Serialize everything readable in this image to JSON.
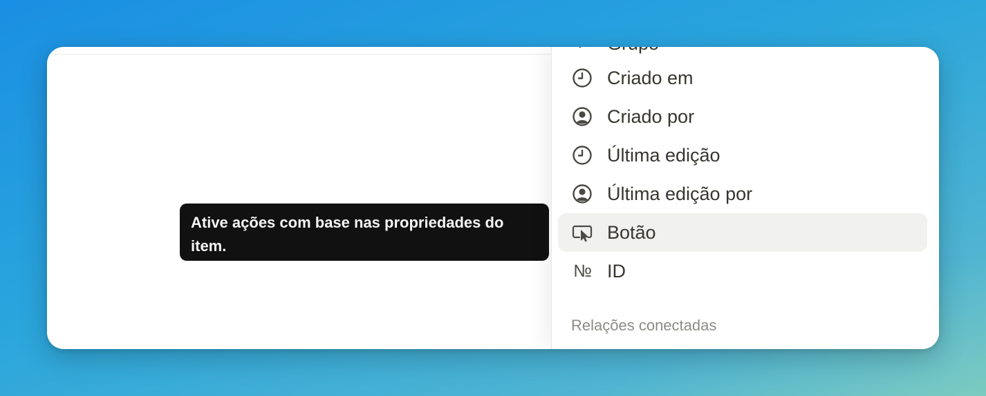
{
  "menu": {
    "partial_item": {
      "label": "Grupo",
      "icon": "partial-icon"
    },
    "items": [
      {
        "label": "Criado em",
        "icon": "clock-icon"
      },
      {
        "label": "Criado por",
        "icon": "user-circle-icon"
      },
      {
        "label": "Última edição",
        "icon": "clock-icon"
      },
      {
        "label": "Última edição por",
        "icon": "user-circle-icon"
      },
      {
        "label": "Botão",
        "icon": "cursor-click-icon",
        "hovered": true
      },
      {
        "label": "ID",
        "icon": "numero-icon",
        "glyph": "№"
      }
    ],
    "section_header": "Relações conectadas"
  },
  "tooltip": {
    "text": "Ative ações com base nas propriedades do item."
  },
  "colors": {
    "text": "#37352f",
    "muted": "#8c8b87",
    "hover_bg": "#f1f1ef",
    "tooltip_bg": "#111111"
  }
}
